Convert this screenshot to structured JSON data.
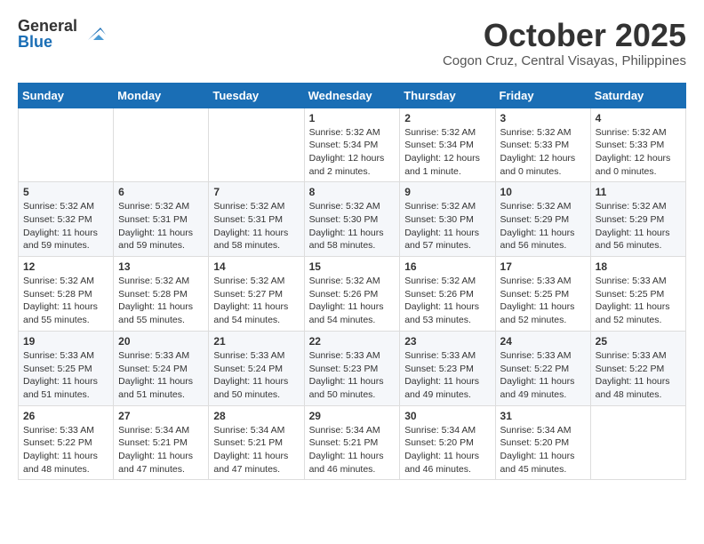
{
  "header": {
    "logo_general": "General",
    "logo_blue": "Blue",
    "month_title": "October 2025",
    "location": "Cogon Cruz, Central Visayas, Philippines"
  },
  "weekdays": [
    "Sunday",
    "Monday",
    "Tuesday",
    "Wednesday",
    "Thursday",
    "Friday",
    "Saturday"
  ],
  "weeks": [
    [
      {
        "day": "",
        "info": ""
      },
      {
        "day": "",
        "info": ""
      },
      {
        "day": "",
        "info": ""
      },
      {
        "day": "1",
        "info": "Sunrise: 5:32 AM\nSunset: 5:34 PM\nDaylight: 12 hours\nand 2 minutes."
      },
      {
        "day": "2",
        "info": "Sunrise: 5:32 AM\nSunset: 5:34 PM\nDaylight: 12 hours\nand 1 minute."
      },
      {
        "day": "3",
        "info": "Sunrise: 5:32 AM\nSunset: 5:33 PM\nDaylight: 12 hours\nand 0 minutes."
      },
      {
        "day": "4",
        "info": "Sunrise: 5:32 AM\nSunset: 5:33 PM\nDaylight: 12 hours\nand 0 minutes."
      }
    ],
    [
      {
        "day": "5",
        "info": "Sunrise: 5:32 AM\nSunset: 5:32 PM\nDaylight: 11 hours\nand 59 minutes."
      },
      {
        "day": "6",
        "info": "Sunrise: 5:32 AM\nSunset: 5:31 PM\nDaylight: 11 hours\nand 59 minutes."
      },
      {
        "day": "7",
        "info": "Sunrise: 5:32 AM\nSunset: 5:31 PM\nDaylight: 11 hours\nand 58 minutes."
      },
      {
        "day": "8",
        "info": "Sunrise: 5:32 AM\nSunset: 5:30 PM\nDaylight: 11 hours\nand 58 minutes."
      },
      {
        "day": "9",
        "info": "Sunrise: 5:32 AM\nSunset: 5:30 PM\nDaylight: 11 hours\nand 57 minutes."
      },
      {
        "day": "10",
        "info": "Sunrise: 5:32 AM\nSunset: 5:29 PM\nDaylight: 11 hours\nand 56 minutes."
      },
      {
        "day": "11",
        "info": "Sunrise: 5:32 AM\nSunset: 5:29 PM\nDaylight: 11 hours\nand 56 minutes."
      }
    ],
    [
      {
        "day": "12",
        "info": "Sunrise: 5:32 AM\nSunset: 5:28 PM\nDaylight: 11 hours\nand 55 minutes."
      },
      {
        "day": "13",
        "info": "Sunrise: 5:32 AM\nSunset: 5:28 PM\nDaylight: 11 hours\nand 55 minutes."
      },
      {
        "day": "14",
        "info": "Sunrise: 5:32 AM\nSunset: 5:27 PM\nDaylight: 11 hours\nand 54 minutes."
      },
      {
        "day": "15",
        "info": "Sunrise: 5:32 AM\nSunset: 5:26 PM\nDaylight: 11 hours\nand 54 minutes."
      },
      {
        "day": "16",
        "info": "Sunrise: 5:32 AM\nSunset: 5:26 PM\nDaylight: 11 hours\nand 53 minutes."
      },
      {
        "day": "17",
        "info": "Sunrise: 5:33 AM\nSunset: 5:25 PM\nDaylight: 11 hours\nand 52 minutes."
      },
      {
        "day": "18",
        "info": "Sunrise: 5:33 AM\nSunset: 5:25 PM\nDaylight: 11 hours\nand 52 minutes."
      }
    ],
    [
      {
        "day": "19",
        "info": "Sunrise: 5:33 AM\nSunset: 5:25 PM\nDaylight: 11 hours\nand 51 minutes."
      },
      {
        "day": "20",
        "info": "Sunrise: 5:33 AM\nSunset: 5:24 PM\nDaylight: 11 hours\nand 51 minutes."
      },
      {
        "day": "21",
        "info": "Sunrise: 5:33 AM\nSunset: 5:24 PM\nDaylight: 11 hours\nand 50 minutes."
      },
      {
        "day": "22",
        "info": "Sunrise: 5:33 AM\nSunset: 5:23 PM\nDaylight: 11 hours\nand 50 minutes."
      },
      {
        "day": "23",
        "info": "Sunrise: 5:33 AM\nSunset: 5:23 PM\nDaylight: 11 hours\nand 49 minutes."
      },
      {
        "day": "24",
        "info": "Sunrise: 5:33 AM\nSunset: 5:22 PM\nDaylight: 11 hours\nand 49 minutes."
      },
      {
        "day": "25",
        "info": "Sunrise: 5:33 AM\nSunset: 5:22 PM\nDaylight: 11 hours\nand 48 minutes."
      }
    ],
    [
      {
        "day": "26",
        "info": "Sunrise: 5:33 AM\nSunset: 5:22 PM\nDaylight: 11 hours\nand 48 minutes."
      },
      {
        "day": "27",
        "info": "Sunrise: 5:34 AM\nSunset: 5:21 PM\nDaylight: 11 hours\nand 47 minutes."
      },
      {
        "day": "28",
        "info": "Sunrise: 5:34 AM\nSunset: 5:21 PM\nDaylight: 11 hours\nand 47 minutes."
      },
      {
        "day": "29",
        "info": "Sunrise: 5:34 AM\nSunset: 5:21 PM\nDaylight: 11 hours\nand 46 minutes."
      },
      {
        "day": "30",
        "info": "Sunrise: 5:34 AM\nSunset: 5:20 PM\nDaylight: 11 hours\nand 46 minutes."
      },
      {
        "day": "31",
        "info": "Sunrise: 5:34 AM\nSunset: 5:20 PM\nDaylight: 11 hours\nand 45 minutes."
      },
      {
        "day": "",
        "info": ""
      }
    ]
  ]
}
